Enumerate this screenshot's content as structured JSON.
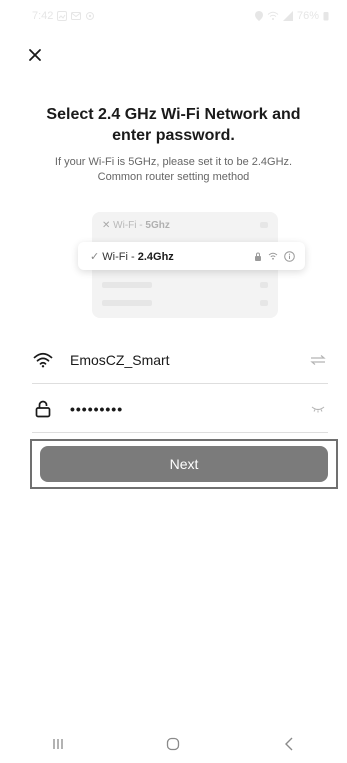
{
  "status_bar": {
    "time": "7:42",
    "battery": "76%"
  },
  "header": {
    "close_label": "×"
  },
  "title": "Select 2.4 GHz Wi-Fi Network and enter password.",
  "subtitle": "If your Wi-Fi is 5GHz, please set it to be 2.4GHz. Common router setting method",
  "illustration": {
    "row_5g_prefix": "Wi-Fi - ",
    "row_5g_band": "5Ghz",
    "row_24g_prefix": "Wi-Fi - ",
    "row_24g_band": "2.4Ghz"
  },
  "wifi_field": {
    "ssid": "EmosCZ_Smart"
  },
  "password_field": {
    "value": "•••••••••"
  },
  "next_button": {
    "label": "Next"
  },
  "colors": {
    "button": "#7b7b7b",
    "outline": "#707070",
    "text": "#1a1a1a",
    "muted": "#666666"
  }
}
